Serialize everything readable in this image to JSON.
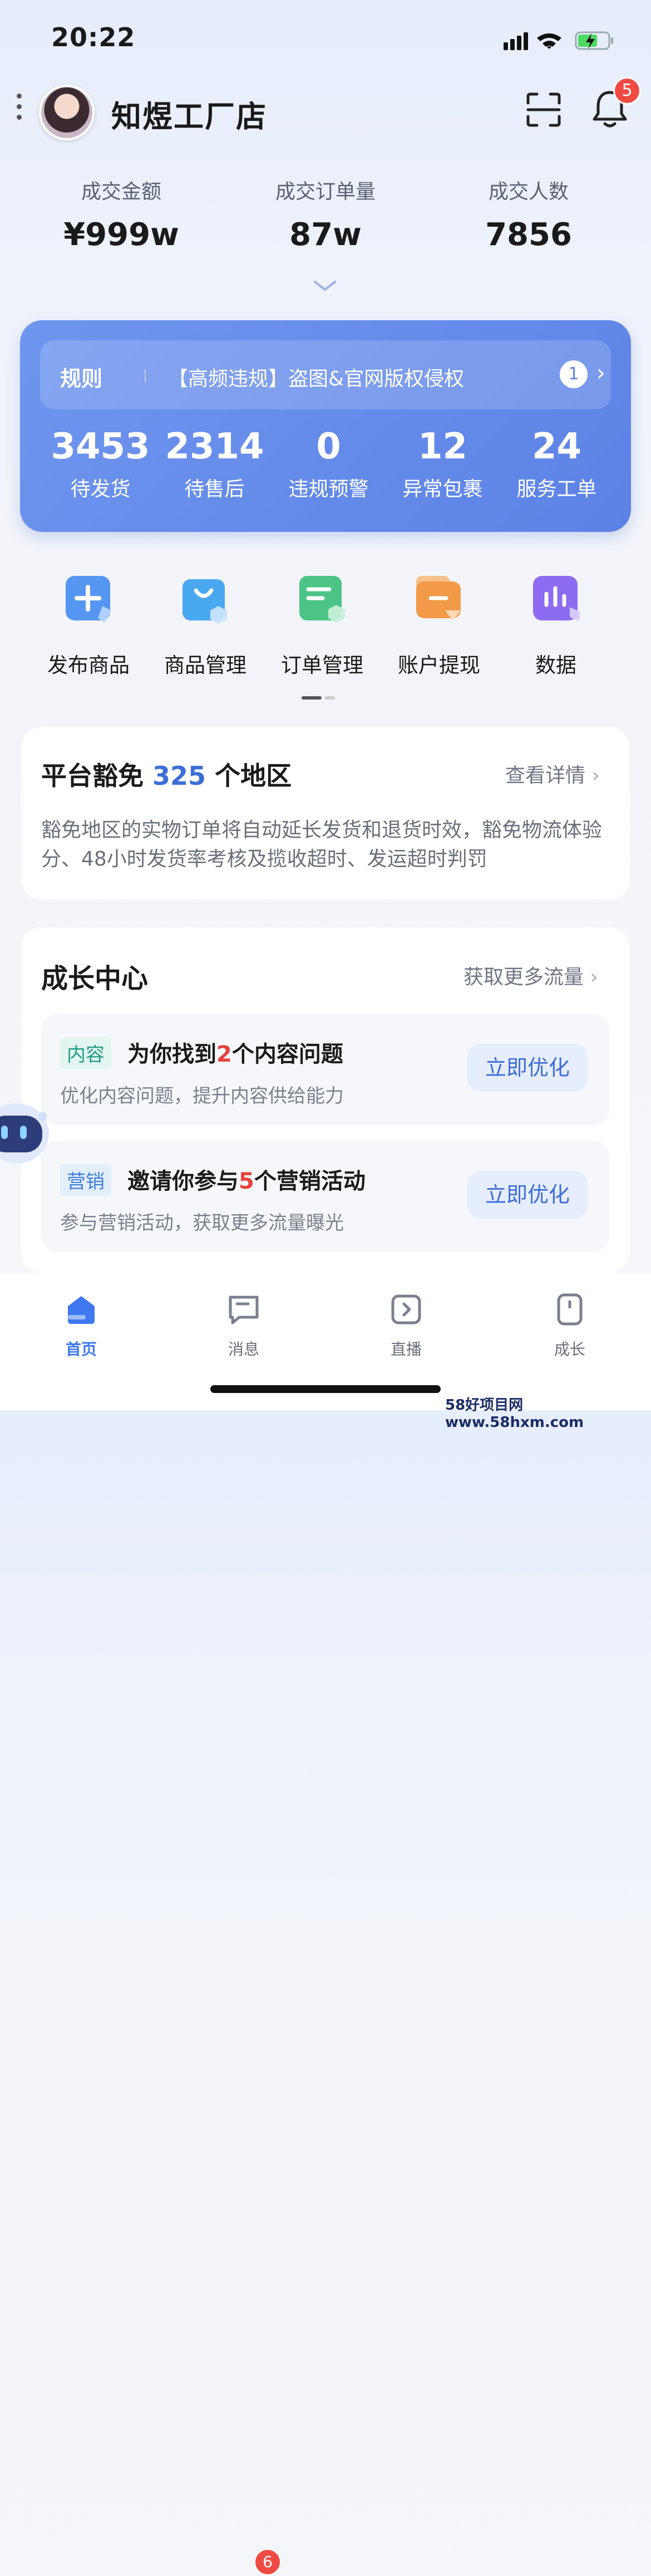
{
  "status_bar": {
    "time": "20:22"
  },
  "header": {
    "store_name": "知煜工厂店",
    "notification_count": "5"
  },
  "stats": [
    {
      "label": "成交金额",
      "value": "¥999w"
    },
    {
      "label": "成交订单量",
      "value": "87w"
    },
    {
      "label": "成交人数",
      "value": "7856"
    }
  ],
  "rule_card": {
    "tag": "规则",
    "text": "【高频违规】盗图&官网版权侵权",
    "count": "1",
    "metrics": [
      {
        "value": "3453",
        "label": "待发货"
      },
      {
        "value": "2314",
        "label": "待售后"
      },
      {
        "value": "0",
        "label": "违规预警"
      },
      {
        "value": "12",
        "label": "异常包裹"
      },
      {
        "value": "24",
        "label": "服务工单"
      }
    ]
  },
  "tools": [
    {
      "label": "发布商品",
      "icon": "plus-icon",
      "color": "#4f8df0"
    },
    {
      "label": "商品管理",
      "icon": "shopping-bag-icon",
      "color": "#4aa8f0"
    },
    {
      "label": "订单管理",
      "icon": "order-doc-icon",
      "color": "#4cc486"
    },
    {
      "label": "账户提现",
      "icon": "wallet-icon",
      "color": "#f29a47"
    },
    {
      "label": "数据",
      "icon": "bar-chart-icon",
      "color": "#8c6cf0"
    }
  ],
  "exempt_card": {
    "title_prefix": "平台豁免",
    "number": "325",
    "title_suffix": "个地区",
    "link": "查看详情",
    "description": "豁免地区的实物订单将自动延长发货和退货时效，豁免物流体验分、48小时发货率考核及揽收超时、发运超时判罚"
  },
  "growth_card": {
    "title": "成长中心",
    "link": "获取更多流量",
    "tasks": [
      {
        "tag": "内容",
        "title_prefix": "为你找到",
        "highlight": "2",
        "title_suffix": "个内容问题",
        "subtitle": "优化内容问题，提升内容供给能力",
        "button": "立即优化",
        "tag_color": "#1f9e86",
        "tag_bg": "#e3f5f0"
      },
      {
        "tag": "营销",
        "title_prefix": "邀请你参与",
        "highlight": "5",
        "title_suffix": "个营销活动",
        "subtitle": "参与营销活动，获取更多流量曝光",
        "button": "立即优化",
        "tag_color": "#3c7fd8",
        "tag_bg": "#e3eefb"
      }
    ]
  },
  "tab_bar": [
    {
      "label": "首页",
      "icon": "home-icon",
      "active": true
    },
    {
      "label": "消息",
      "icon": "message-icon",
      "badge": "6"
    },
    {
      "label": "直播",
      "icon": "live-icon"
    },
    {
      "label": "成长",
      "icon": "growth-icon"
    }
  ],
  "watermark": "58好项目网www.58hxm.com"
}
